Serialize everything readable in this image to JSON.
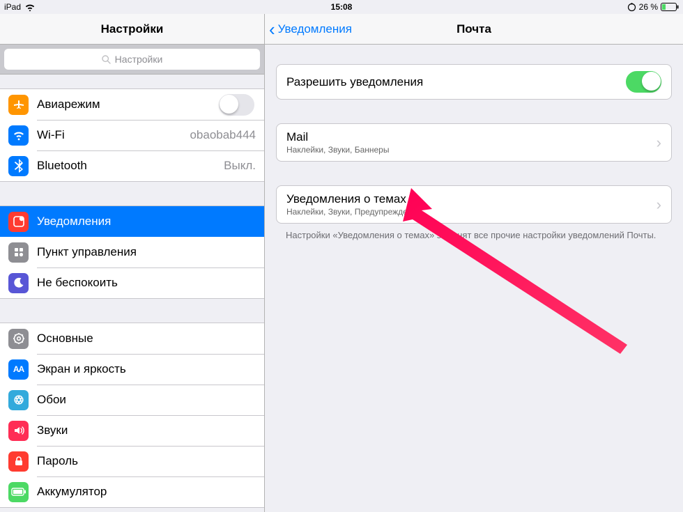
{
  "status": {
    "device": "iPad",
    "time": "15:08",
    "battery_text": "26 %"
  },
  "sidebar": {
    "title": "Настройки",
    "search_placeholder": "Настройки",
    "groups": [
      {
        "items": [
          {
            "key": "airplane",
            "label": "Авиарежим",
            "accessory": "toggle-off",
            "icon_bg": "#ff9500"
          },
          {
            "key": "wifi",
            "label": "Wi-Fi",
            "value": "obaobab444",
            "icon_bg": "#007aff"
          },
          {
            "key": "bluetooth",
            "label": "Bluetooth",
            "value": "Выкл.",
            "icon_bg": "#007aff"
          }
        ]
      },
      {
        "items": [
          {
            "key": "notifications",
            "label": "Уведомления",
            "selected": true,
            "icon_bg": "#ff3b30"
          },
          {
            "key": "controlcenter",
            "label": "Пункт управления",
            "icon_bg": "#8e8e93"
          },
          {
            "key": "dnd",
            "label": "Не беспокоить",
            "icon_bg": "#5856d6"
          }
        ]
      },
      {
        "items": [
          {
            "key": "general",
            "label": "Основные",
            "icon_bg": "#8e8e93"
          },
          {
            "key": "display",
            "label": "Экран и яркость",
            "icon_bg": "#007aff"
          },
          {
            "key": "wallpaper",
            "label": "Обои",
            "icon_bg": "#32aadc"
          },
          {
            "key": "sounds",
            "label": "Звуки",
            "icon_bg": "#ff2d55"
          },
          {
            "key": "passcode",
            "label": "Пароль",
            "icon_bg": "#ff3b30"
          },
          {
            "key": "battery",
            "label": "Аккумулятор",
            "icon_bg": "#4cd964"
          }
        ]
      }
    ]
  },
  "detail": {
    "back_label": "Уведомления",
    "title": "Почта",
    "allow_label": "Разрешить уведомления",
    "allow_on": true,
    "accounts": [
      {
        "title": "Mail",
        "subtitle": "Наклейки, Звуки, Баннеры"
      }
    ],
    "threads": [
      {
        "title": "Уведомления о темах",
        "subtitle": "Наклейки, Звуки, Предупреждения"
      }
    ],
    "footer": "Настройки «Уведомления о темах» заменят все прочие настройки уведомлений Почты."
  },
  "annotation": {
    "color": "#ff0055"
  }
}
